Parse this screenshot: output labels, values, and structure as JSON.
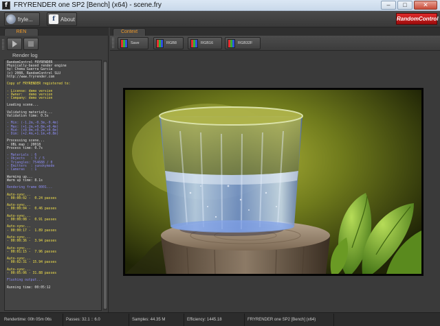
{
  "window": {
    "app_icon_letter": "f",
    "title": "FRYRENDER one SP2 [Bench] (x64) - scene.fry",
    "buttons": {
      "minimize": "–",
      "maximize": "□",
      "close": "✕"
    }
  },
  "toolbar": {
    "fryle_label": "fryle...",
    "about_label": "About",
    "about_icon_letter": "f",
    "brand_logo": "RandomControl"
  },
  "left_panel": {
    "tab_label": "REN",
    "log_label": "Render log",
    "log_lines": [
      {
        "text": "RandomControl FRYRENDER",
        "tone": "white"
      },
      {
        "text": "Physically-based render engine",
        "tone": "white"
      },
      {
        "text": "by: Chema Guerra Garcia",
        "tone": "white"
      },
      {
        "text": "(c) 2008, RandomControl SLU",
        "tone": "white"
      },
      {
        "text": "http://www.fryrender.com",
        "tone": "white"
      },
      {
        "text": "",
        "tone": "white"
      },
      {
        "text": "Copy of FRYRENDER registered to:",
        "tone": "yellow"
      },
      {
        "text": "",
        "tone": "white"
      },
      {
        "text": "- License: demo version",
        "tone": "yellow"
      },
      {
        "text": "- Owner:   demo version",
        "tone": "yellow"
      },
      {
        "text": "- Company: demo version",
        "tone": "yellow"
      },
      {
        "text": "",
        "tone": "white"
      },
      {
        "text": "Loading scene...",
        "tone": "white"
      },
      {
        "text": "",
        "tone": "white"
      },
      {
        "text": "Validating materials...",
        "tone": "white"
      },
      {
        "text": "Validation time: 0.5s",
        "tone": "white"
      },
      {
        "text": "",
        "tone": "white"
      },
      {
        "text": "- Min: (-1.2m,-0.3m,-0.4m)",
        "tone": "blue"
      },
      {
        "text": "- Max: (+1.2m,+0.8m,+0.4m)",
        "tone": "blue"
      },
      {
        "text": "- Mid: (+0.0m,+0.2m,+0.0m)",
        "tone": "blue"
      },
      {
        "text": "- Dim: (+2.4m,+1.1m,+0.8m)",
        "tone": "blue"
      },
      {
        "text": "",
        "tone": "white"
      },
      {
        "text": "Processing scene...",
        "tone": "white"
      },
      {
        "text": "- OBL map : 20018",
        "tone": "white"
      },
      {
        "text": "Process time: 0.7s",
        "tone": "white"
      },
      {
        "text": "",
        "tone": "white"
      },
      {
        "text": "- Materials : 6",
        "tone": "blue"
      },
      {
        "text": "- Objects   : 5 / 5",
        "tone": "blue"
      },
      {
        "text": "- Triangles: 754688 / 0",
        "tone": "blue"
      },
      {
        "text": "- Emitters  : sunskymode",
        "tone": "blue"
      },
      {
        "text": "- Cameras   : 1",
        "tone": "blue"
      },
      {
        "text": "",
        "tone": "white"
      },
      {
        "text": "Warming up...",
        "tone": "white"
      },
      {
        "text": "Warm up time: 8.1s",
        "tone": "white"
      },
      {
        "text": "",
        "tone": "white"
      },
      {
        "text": "Rendering frame 0001...",
        "tone": "blue"
      },
      {
        "text": "",
        "tone": "white"
      },
      {
        "text": "Auto-sync...",
        "tone": "yellow"
      },
      {
        "text": "- 00:00:02 -  0.24 passes",
        "tone": "yellow"
      },
      {
        "text": "",
        "tone": "white"
      },
      {
        "text": "Auto-sync...",
        "tone": "yellow"
      },
      {
        "text": "- 00:00:04 -  0.46 passes",
        "tone": "yellow"
      },
      {
        "text": "",
        "tone": "white"
      },
      {
        "text": "Auto-sync...",
        "tone": "yellow"
      },
      {
        "text": "- 00:00:08 -  0.91 passes",
        "tone": "yellow"
      },
      {
        "text": "",
        "tone": "white"
      },
      {
        "text": "Auto-sync...",
        "tone": "yellow"
      },
      {
        "text": "- 00:00:17 -  1.89 passes",
        "tone": "yellow"
      },
      {
        "text": "",
        "tone": "white"
      },
      {
        "text": "Auto-sync...",
        "tone": "yellow"
      },
      {
        "text": "- 00:00:36 -  3.94 passes",
        "tone": "yellow"
      },
      {
        "text": "",
        "tone": "white"
      },
      {
        "text": "Auto-sync...",
        "tone": "yellow"
      },
      {
        "text": "- 00:01:15 -  7.96 passes",
        "tone": "yellow"
      },
      {
        "text": "",
        "tone": "white"
      },
      {
        "text": "Auto-sync...",
        "tone": "yellow"
      },
      {
        "text": "- 00:02:31 - 15.94 passes",
        "tone": "yellow"
      },
      {
        "text": "",
        "tone": "white"
      },
      {
        "text": "Auto-sync...",
        "tone": "yellow"
      },
      {
        "text": "- 00:05:06 - 31.88 passes",
        "tone": "yellow"
      },
      {
        "text": "",
        "tone": "white"
      },
      {
        "text": "Flushing output...",
        "tone": "blue"
      },
      {
        "text": "",
        "tone": "white"
      },
      {
        "text": "Running time: 00:05:12",
        "tone": "white"
      }
    ]
  },
  "right_panel": {
    "tab_label": "Context",
    "buttons": {
      "save": "Save",
      "rgb8": "RGB8",
      "rgb16": "RGB16",
      "rgb32f": "RGB32F"
    }
  },
  "status": {
    "rendertime": "Rendertime:  00h 05m 06s",
    "passes": "Passes:  32.1 :: 6.0",
    "samples": "Samples:  44.35 M",
    "efficiency": "Efficiency:  1445.18",
    "version": "FRYRENDER one SP2 [Bench] (x64)"
  }
}
